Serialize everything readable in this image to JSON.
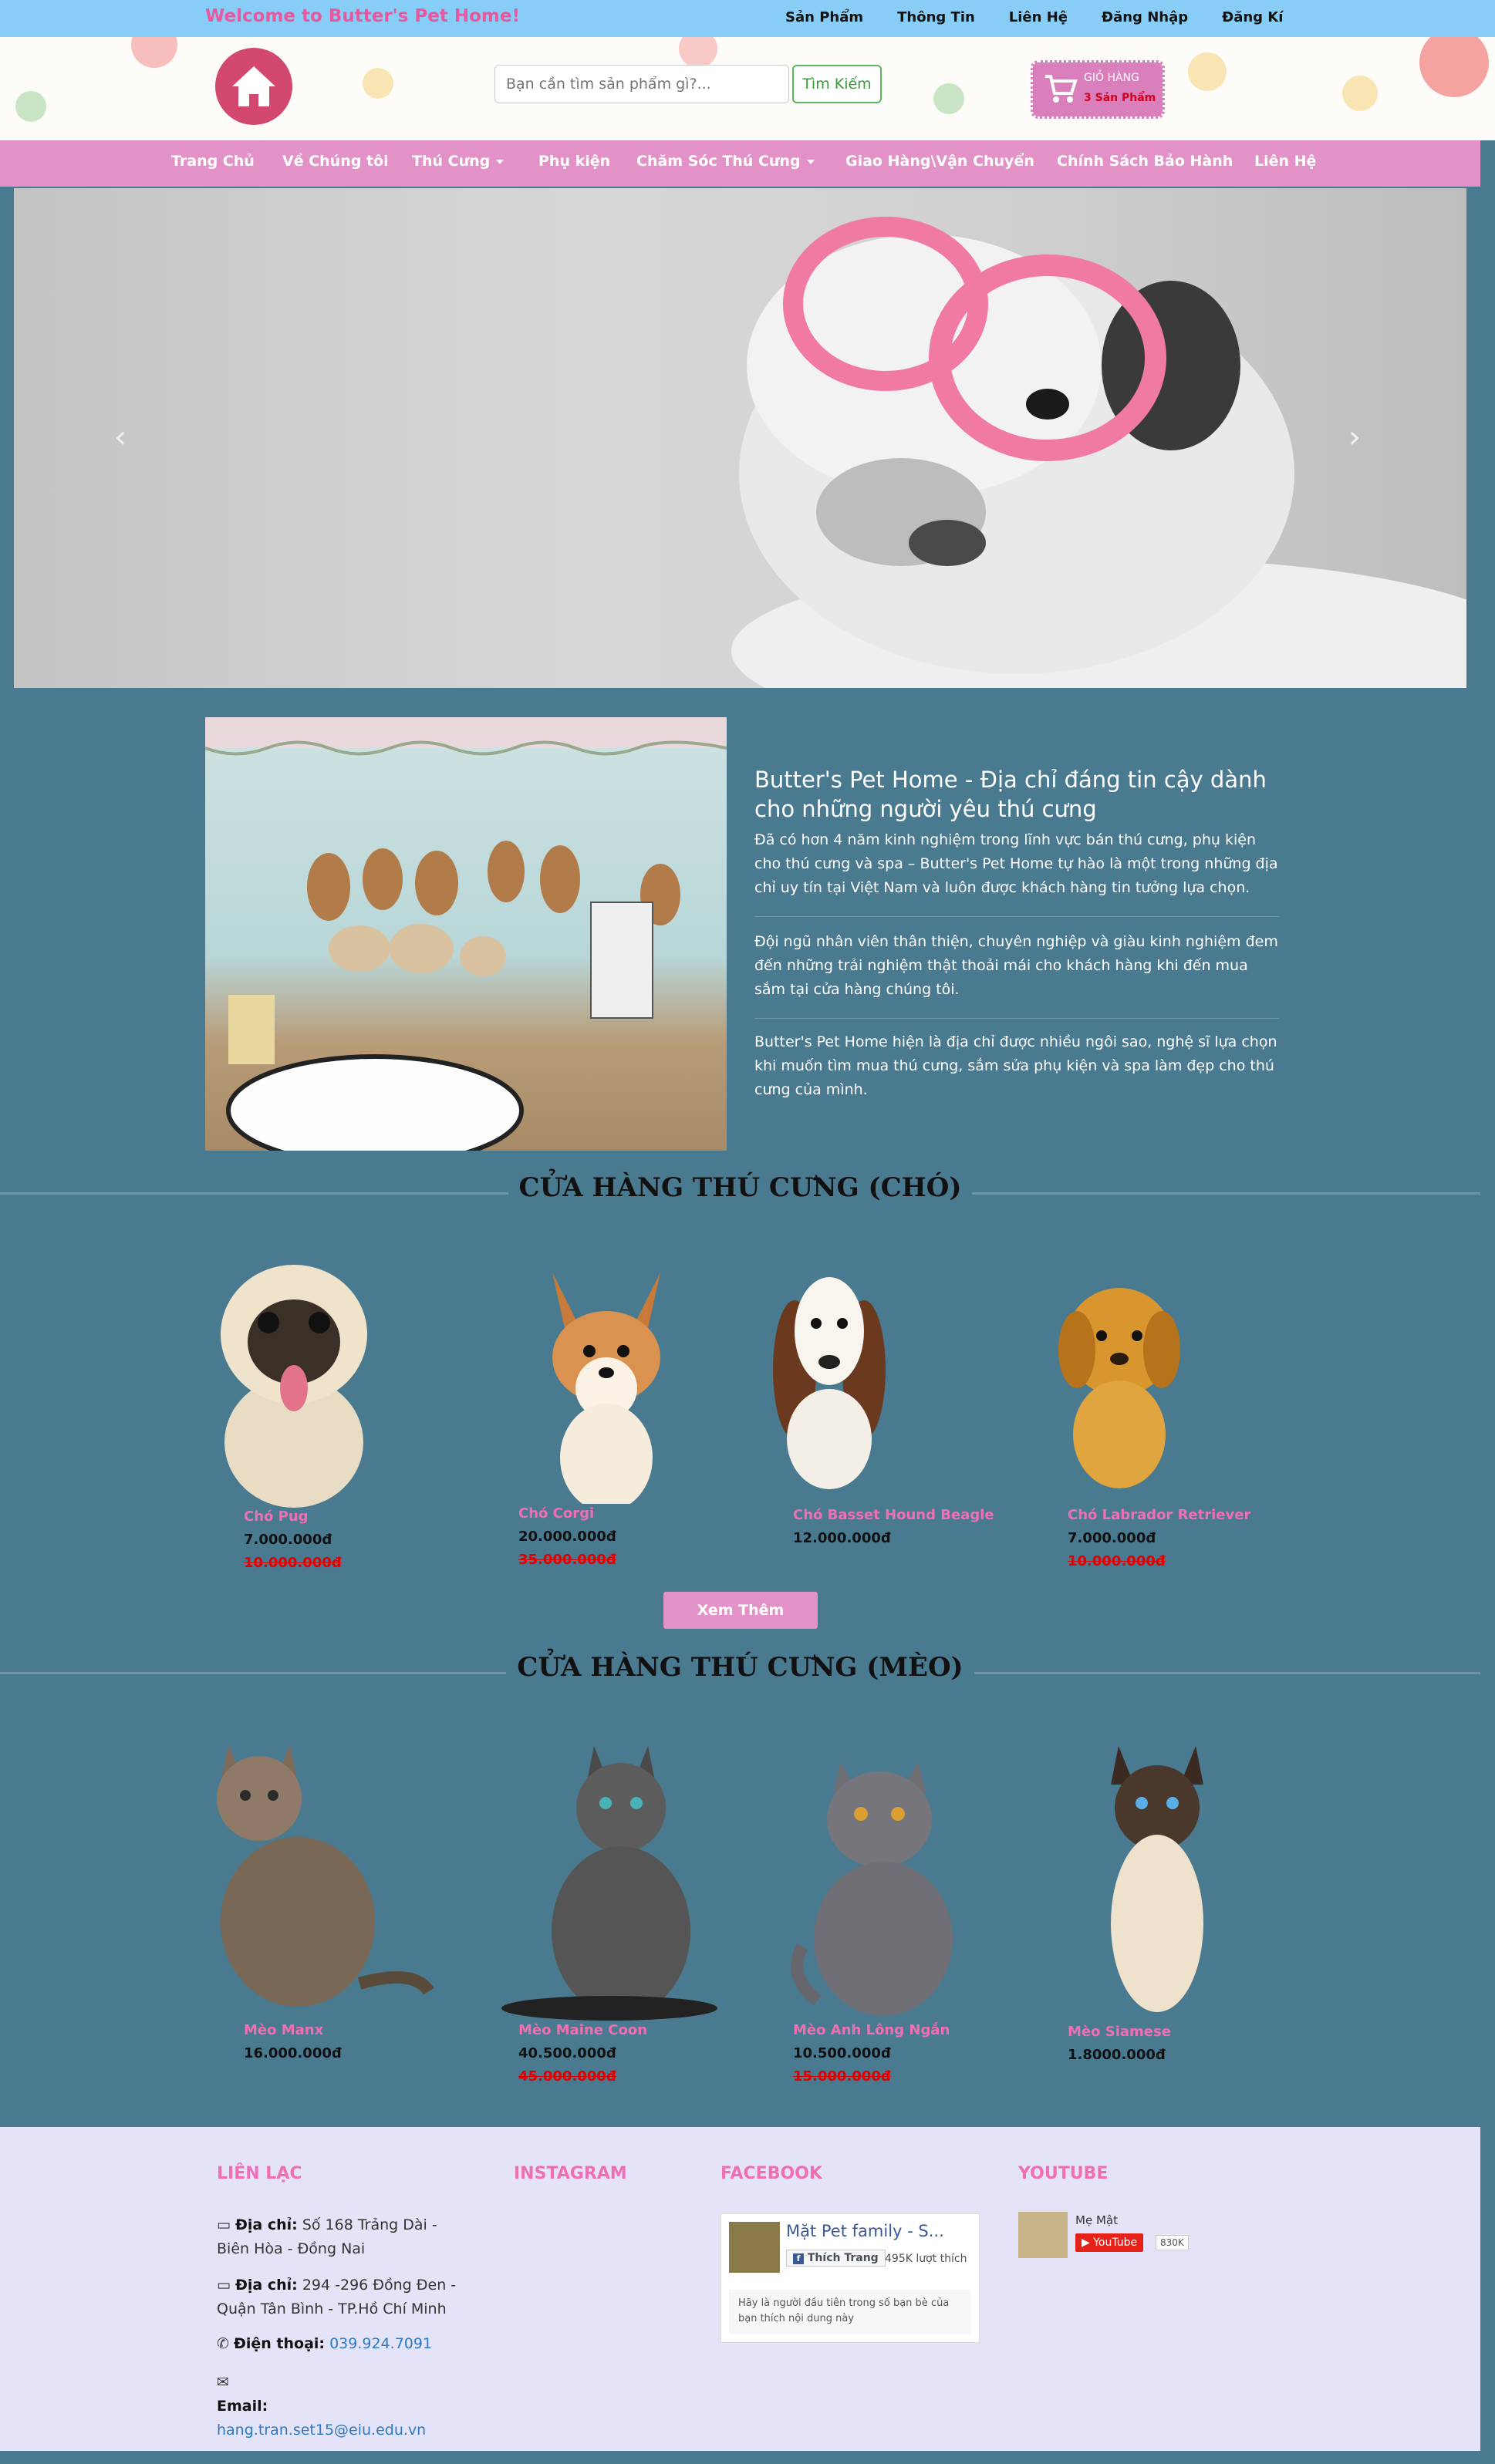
{
  "topbar": {
    "welcome": "Welcome to Butter's Pet Home!",
    "links": [
      "Sản Phẩm",
      "Thông Tin",
      "Liên Hệ",
      "Đăng Nhập",
      "Đăng Kí"
    ]
  },
  "header": {
    "search_placeholder": "Bạn cần tìm sản phẩm gì?...",
    "search_button": "Tìm Kiếm",
    "cart_label": "GIỎ HÀNG",
    "cart_count": "3 Sản Phẩm"
  },
  "nav": {
    "items": [
      "Trang Chủ",
      "Về Chúng tôi",
      "Thú Cưng",
      "Phụ kiện",
      "Chăm Sóc Thú Cưng",
      "Giao Hàng\\Vận Chuyển",
      "Chính Sách Bảo Hành",
      "Liên Hệ"
    ]
  },
  "about": {
    "title": "Butter's Pet Home - Địa chỉ đáng tin cậy dành cho những người yêu thú cưng",
    "p1": "Đã có hơn 4 năm kinh nghiệm trong lĩnh vực bán thú cưng, phụ kiện cho thú cưng và spa – Butter's Pet Home tự hào là một trong những địa chỉ uy tín tại Việt Nam và luôn được khách hàng tin tưởng lựa chọn.",
    "p2": "Đội ngũ nhân viên thân thiện, chuyên nghiệp và giàu kinh nghiệm đem đến những trải nghiệm thật thoải mái cho khách hàng khi đến mua sắm tại cửa hàng chúng tôi.",
    "p3": "Butter's Pet Home hiện là địa chỉ được nhiều ngôi sao, nghệ sĩ lựa chọn khi muốn tìm mua thú cưng, sắm sửa phụ kiện và spa làm đẹp cho thú cưng của mình."
  },
  "dogs": {
    "title": "CỬA HÀNG THÚ CƯNG (CHÓ)",
    "items": [
      {
        "name": "Chó Pug",
        "price": "7.000.000đ",
        "old": "10.000.000đ"
      },
      {
        "name": "Chó Corgi",
        "price": "20.000.000đ",
        "old": "35.000.000đ"
      },
      {
        "name": "Chó Basset Hound Beagle",
        "price": "12.000.000đ",
        "old": ""
      },
      {
        "name": "Chó Labrador Retriever",
        "price": "7.000.000đ",
        "old": "10.000.000đ"
      }
    ],
    "more": "Xem Thêm"
  },
  "cats": {
    "title": "CỬA HÀNG THÚ CƯNG (MÈO)",
    "items": [
      {
        "name": "Mèo Manx",
        "price": "16.000.000đ",
        "old": ""
      },
      {
        "name": "Mèo Maine Coon",
        "price": "40.500.000đ",
        "old": "45.000.000đ"
      },
      {
        "name": "Mèo Anh Lông Ngắn",
        "price": "10.500.000đ",
        "old": "15.000.000đ"
      },
      {
        "name": "Mèo Siamese",
        "price": "1.8000.000đ",
        "old": ""
      }
    ]
  },
  "footer": {
    "contact_title": "LIÊN LẠC",
    "instagram_title": "INSTAGRAM",
    "facebook_title": "FACEBOOK",
    "youtube_title": "YOUTUBE",
    "addr_label": "Địa chỉ:",
    "addr1": "Số 168 Trảng Dài - Biên Hòa - Đồng Nai",
    "addr2": "294 -296 Đồng Đen - Quận Tân Bình - TP.Hồ Chí Minh",
    "phone_label": "Điện thoại:",
    "phone": "039.924.7091",
    "email_label": "Email:",
    "email": "hang.tran.set15@eiu.edu.vn",
    "fb_page": "Mặt Pet family - S...",
    "fb_like": "Thích Trang",
    "fb_count": "495K lượt thích",
    "fb_note": "Hãy là người đầu tiên trong số bạn bè của bạn thích nội dung này",
    "yt_channel": "Mẹ Mật",
    "yt_button": "YouTube",
    "yt_count": "830K"
  }
}
